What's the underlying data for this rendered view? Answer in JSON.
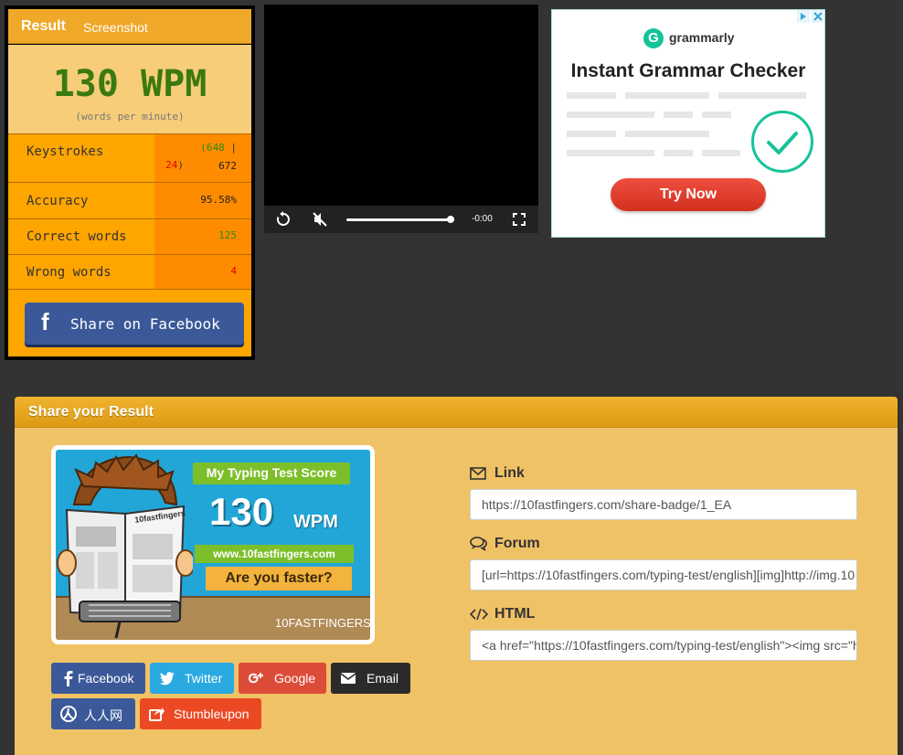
{
  "result": {
    "tabs": {
      "result": "Result",
      "screenshot": "Screenshot"
    },
    "wpm": "130 WPM",
    "wpm_caption": "(words per minute)",
    "stats": {
      "keystrokes": {
        "label": "Keystrokes",
        "open": "(",
        "correct": "648",
        "sep": "|",
        "wrong": "24",
        "close": ")",
        "total": "672"
      },
      "accuracy": {
        "label": "Accuracy",
        "value": "95.58%"
      },
      "correct_words": {
        "label": "Correct words",
        "value": "125"
      },
      "wrong_words": {
        "label": "Wrong words",
        "value": "4"
      }
    },
    "share_button": {
      "icon": "f",
      "label": "Share on Facebook"
    }
  },
  "video": {
    "time": "-0:00",
    "progress": 0.97
  },
  "ad": {
    "brand": "grammarly",
    "brand_initial": "G",
    "headline": "Instant Grammar Checker",
    "cta": "Try Now"
  },
  "share": {
    "title": "Share your Result",
    "badge": {
      "title": "My Typing Test Score",
      "score": "130",
      "unit": "WPM",
      "url": "www.10fastfingers.com",
      "cta": "Are you faster?",
      "paper_label": "10fastfingers",
      "logo": "10FASTFINGERS"
    },
    "buttons": [
      {
        "label": "Facebook",
        "color": "#3b5998"
      },
      {
        "label": "Twitter",
        "color": "#2aa9e0"
      },
      {
        "label": "Google",
        "color": "#dd4b39"
      },
      {
        "label": "Email",
        "color": "#2b2b2b"
      },
      {
        "label": "人人网",
        "color": "#3b5998"
      },
      {
        "label": "Stumbleupon",
        "color": "#eb4924"
      }
    ],
    "fields": {
      "link": {
        "label": "Link",
        "value": "https://10fastfingers.com/share-badge/1_EA"
      },
      "forum": {
        "label": "Forum",
        "value": "[url=https://10fastfingers.com/typing-test/english][img]http://img.10"
      },
      "html": {
        "label": "HTML",
        "value": "<a href=\"https://10fastfingers.com/typing-test/english\"><img src=\"h"
      }
    }
  }
}
